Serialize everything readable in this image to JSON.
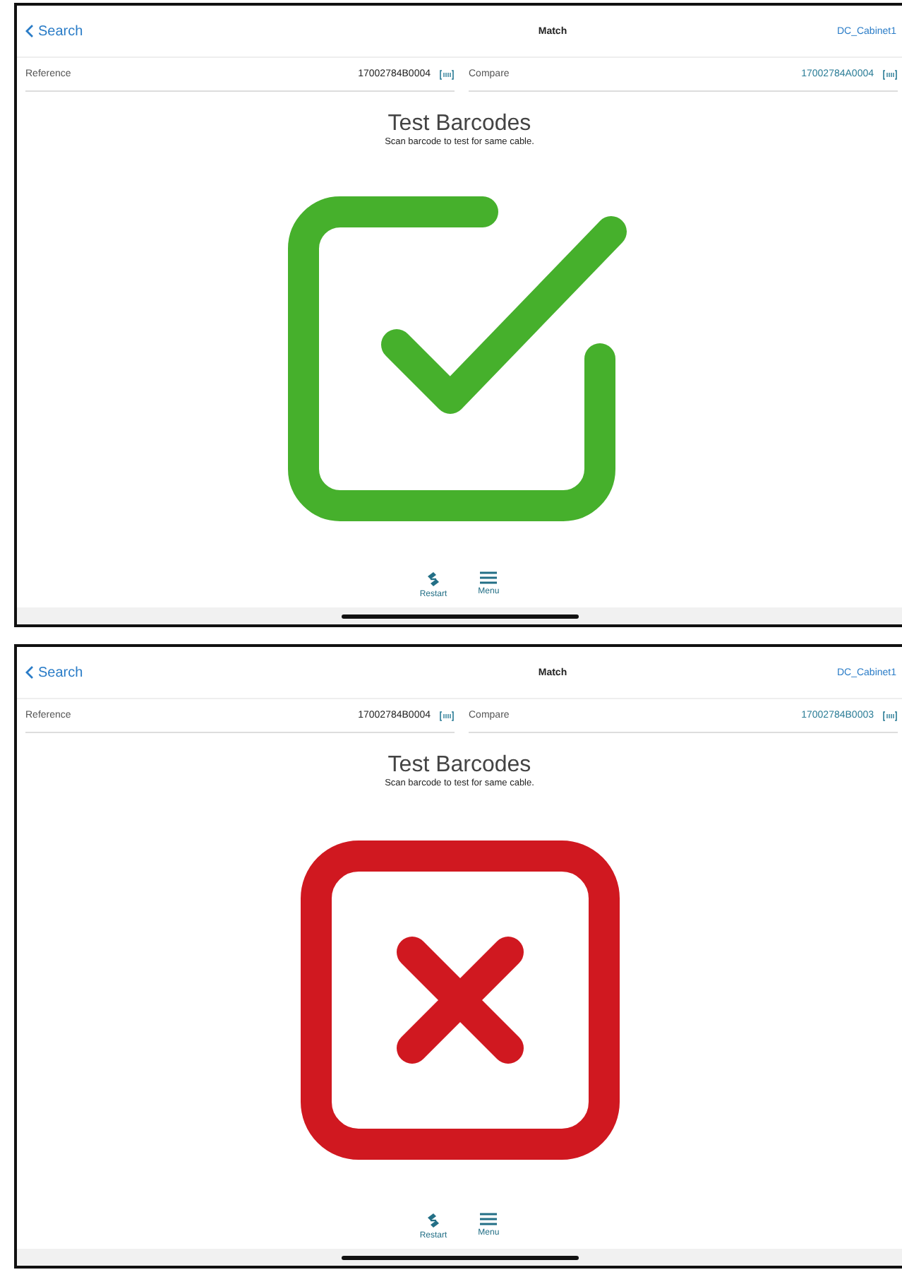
{
  "screens": [
    {
      "nav": {
        "back": "Search",
        "title": "Match",
        "right": "DC_Cabinet1"
      },
      "reference": {
        "label": "Reference",
        "value": "17002784B0004"
      },
      "compare": {
        "label": "Compare",
        "value": "17002784A0004"
      },
      "heading": "Test Barcodes",
      "subheading": "Scan barcode to test for same cable.",
      "result": {
        "kind": "match"
      },
      "toolbar": [
        {
          "kind": "restart",
          "label": "Restart"
        },
        {
          "kind": "menu",
          "label": "Menu"
        }
      ]
    },
    {
      "nav": {
        "back": "Search",
        "title": "Match",
        "right": "DC_Cabinet1"
      },
      "reference": {
        "label": "Reference",
        "value": "17002784B0004"
      },
      "compare": {
        "label": "Compare",
        "value": "17002784B0003"
      },
      "heading": "Test Barcodes",
      "subheading": "Scan barcode to test for same cable.",
      "result": {
        "kind": "mismatch"
      },
      "toolbar": [
        {
          "kind": "restart",
          "label": "Restart"
        },
        {
          "kind": "menu",
          "label": "Menu"
        }
      ]
    }
  ]
}
